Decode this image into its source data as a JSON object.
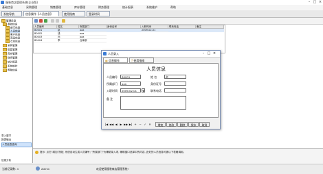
{
  "window": {
    "title": "服装商店管理系统(企业版)"
  },
  "menu": [
    "基础信息",
    "采购管理",
    "销售管理",
    "库存管理",
    "财务管理",
    "统计报表",
    "系统维护",
    "帮助"
  ],
  "tabs": [
    {
      "label": "系统导航"
    },
    {
      "label": "信息操作【人员信息】"
    },
    {
      "label": "使用指南"
    },
    {
      "label": "登录时间"
    }
  ],
  "sidebar": {
    "tree": [
      {
        "label": "管理目录"
      },
      {
        "label": "基础信息"
      },
      {
        "label": "部门信息"
      },
      {
        "label": "人员信息"
      },
      {
        "label": "客户信息"
      },
      {
        "label": "商品信息"
      },
      {
        "label": "仓库信息"
      },
      {
        "label": "采购管理"
      },
      {
        "label": "销售管理"
      },
      {
        "label": "库存管理"
      },
      {
        "label": "财务管理"
      },
      {
        "label": "统计报表"
      },
      {
        "label": "系统维护"
      },
      {
        "label": "帮助信息"
      }
    ],
    "buttons": [
      {
        "label": "录入窗口"
      },
      {
        "label": "报表输出"
      },
      {
        "label": "人员信息查询"
      }
    ],
    "bottom_label": "信息分析"
  },
  "grid": {
    "columns": [
      "人员编号",
      "姓名",
      "所属部门",
      "身份证号",
      "入职时间",
      "联系电话",
      "备注"
    ],
    "rows": [
      [
        "B0001",
        "赵",
        "aaa",
        "",
        "2009-02-01",
        "",
        ""
      ],
      [
        "B0002",
        "钱",
        "aaa",
        "",
        "",
        "",
        ""
      ],
      [
        "B0003",
        "孙",
        "aaa",
        "",
        "",
        "",
        ""
      ],
      [
        "B0004",
        "李",
        "仓库部",
        "",
        "",
        "",
        ""
      ]
    ]
  },
  "dialog": {
    "title": "人员录入",
    "tabs": [
      "信息操作",
      "使用指南"
    ],
    "heading": "人员信息",
    "labels": {
      "id": "人员编号",
      "name": "姓  名",
      "dept": "所属部门",
      "idcard": "身份证号",
      "hire_date": "入职时间",
      "phone": "联系电话",
      "remark": "备  注"
    },
    "values": {
      "id": "B0001",
      "name": "赵",
      "dept": "aaa",
      "idcard": "",
      "hire_date": "2009-02-01",
      "phone": "",
      "remark": ""
    },
    "nav_symbols": [
      "|◀",
      "◀◀",
      "◀",
      "▶",
      "▶▶",
      "▶|",
      "+",
      "−",
      "✓",
      "✕"
    ],
    "buttons": [
      "增加",
      "修改",
      "删除",
      "保存",
      "取消"
    ]
  },
  "hint": {
    "text": "提示: 点击\"增加\"按钮, 系统自动生成人员编号; \"所属部门\"为辅助录入项, 辅助窗口选择中的内容, 此处的人员信息可被以下表格调用。"
  },
  "status": {
    "left": "当前记录数: 4",
    "user": "Admin",
    "message": "欢迎使用服装商店管理系统!"
  },
  "colors": {
    "accent": "#3a7bd5",
    "dialog_border": "#7a8fb5",
    "selection": "#cfe3fb"
  }
}
